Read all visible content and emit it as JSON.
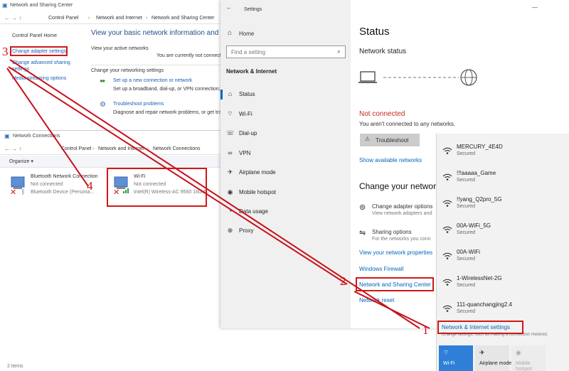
{
  "nsc": {
    "title": "Network and Sharing Center",
    "breadcrumb": [
      "Control Panel",
      "Network and Internet",
      "Network and Sharing Center"
    ],
    "sidebar": [
      "Control Panel Home",
      "Change adapter settings",
      "Change advanced sharing settings",
      "Media streaming options"
    ],
    "heading": "View your basic network information and set",
    "active_networks_label": "View your active networks",
    "not_connected_text": "You are currently not connect",
    "change_settings_label": "Change your networking settings",
    "setup_link": "Set up a new connection or network",
    "setup_desc": "Set up a broadband, dial-up, or VPN connection; o",
    "troubleshoot_link": "Troubleshoot problems",
    "troubleshoot_desc": "Diagnose and repair network problems, or get trou"
  },
  "nc": {
    "title": "Network Connections",
    "breadcrumb": [
      "Control Panel",
      "Network and Internet",
      "Network Connections"
    ],
    "organize": "Organize ▾",
    "adapters": [
      {
        "name": "Bluetooth Network Connection",
        "status": "Not connected",
        "device": "Bluetooth Device (Persona..."
      },
      {
        "name": "Wi-Fi",
        "status": "Not connected",
        "device": "Intel(R) Wireless-AC 9560 160M..."
      }
    ],
    "item_count": "2 items"
  },
  "settings": {
    "title": "Settings",
    "home": "Home",
    "search_placeholder": "Find a setting",
    "section": "Network & Internet",
    "nav": [
      "Status",
      "Wi-Fi",
      "Dial-up",
      "VPN",
      "Airplane mode",
      "Mobile hotspot",
      "Data usage",
      "Proxy"
    ],
    "page_title": "Status",
    "network_status": "Network status",
    "not_connected": "Not connected",
    "not_connected_desc": "You aren't connected to any networks.",
    "troubleshoot_btn": "Troubleshoot",
    "show_available": "Show available networks",
    "change_heading": "Change your network",
    "adapter_options": "Change adapter options",
    "adapter_options_desc": "View network adapters and",
    "sharing_options": "Sharing options",
    "sharing_options_desc": "For the networks you conn",
    "view_properties": "View your network properties",
    "firewall": "Windows Firewall",
    "nsc_link": "Network and Sharing Center",
    "reset": "Network reset",
    "status_color": "#c42b1c",
    "accent_color": "#0067c0"
  },
  "flyout": {
    "networks": [
      {
        "name": "MERCURY_4E4D",
        "status": "Secured"
      },
      {
        "name": "!!!aaaaa_Game",
        "status": "Secured"
      },
      {
        "name": "!!yang_Q2pro_5G",
        "status": "Secured"
      },
      {
        "name": "00A-WiFi_5G",
        "status": "Secured"
      },
      {
        "name": "00A-WiFi",
        "status": "Secured"
      },
      {
        "name": "1-WirelessNet-2G",
        "status": "Secured"
      },
      {
        "name": "111-quanchangjing2.4",
        "status": "Secured"
      }
    ],
    "settings_link": "Network & Internet settings",
    "settings_desc": "Change settings, such as making a connection metered.",
    "tiles": [
      "Wi-Fi",
      "Airplane mode",
      "Mobile hotspot"
    ]
  },
  "annotations": [
    "1",
    "2",
    "3",
    "4"
  ]
}
